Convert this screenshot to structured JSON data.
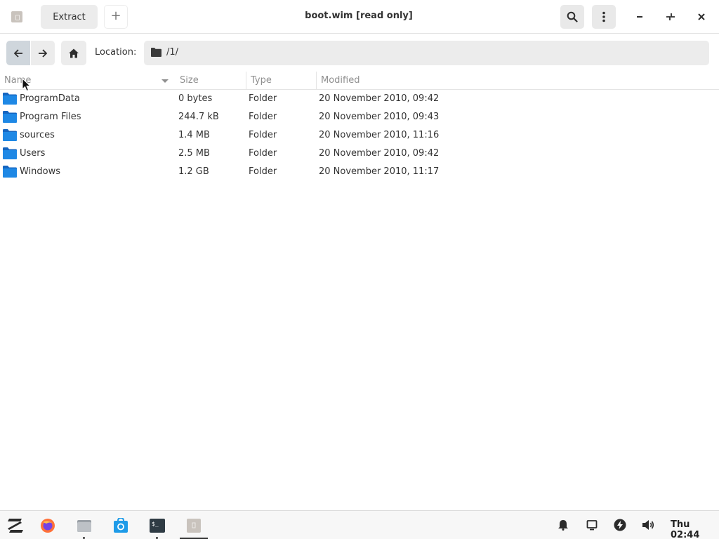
{
  "header": {
    "app_icon": "archive-icon",
    "extract_label": "Extract",
    "new_tab_label": "+",
    "title": "boot.wim [read only]",
    "search_icon": "search-icon",
    "menu_icon": "kebab-menu-icon",
    "minimize_icon": "minimize-icon",
    "restore_icon": "restore-icon",
    "close_icon": "close-icon"
  },
  "toolbar": {
    "back_icon": "arrow-left-icon",
    "forward_icon": "arrow-right-icon",
    "home_icon": "home-icon",
    "location_label": "Location:",
    "location_path": "/1/"
  },
  "columns": {
    "name": "Name",
    "size": "Size",
    "type": "Type",
    "modified": "Modified"
  },
  "files": [
    {
      "name": "ProgramData",
      "size": "0 bytes",
      "type": "Folder",
      "modified": "20 November 2010, 09:42"
    },
    {
      "name": "Program Files",
      "size": "244.7 kB",
      "type": "Folder",
      "modified": "20 November 2010, 09:43"
    },
    {
      "name": "sources",
      "size": "1.4 MB",
      "type": "Folder",
      "modified": "20 November 2010, 11:16"
    },
    {
      "name": "Users",
      "size": "2.5 MB",
      "type": "Folder",
      "modified": "20 November 2010, 09:42"
    },
    {
      "name": "Windows",
      "size": "1.2 GB",
      "type": "Folder",
      "modified": "20 November 2010, 11:17"
    }
  ],
  "taskbar": {
    "apps": [
      "zorin-menu-icon",
      "firefox-icon",
      "files-icon",
      "software-store-icon",
      "terminal-icon",
      "archive-manager-icon"
    ],
    "tray": [
      "notifications-icon",
      "display-icon",
      "power-icon",
      "volume-icon"
    ],
    "clock": "Thu 02:44"
  },
  "colors": {
    "folder_blue": "#1e88e5",
    "folder_blue_light": "#42a5f5",
    "active_nav": "#cfd6dc"
  }
}
